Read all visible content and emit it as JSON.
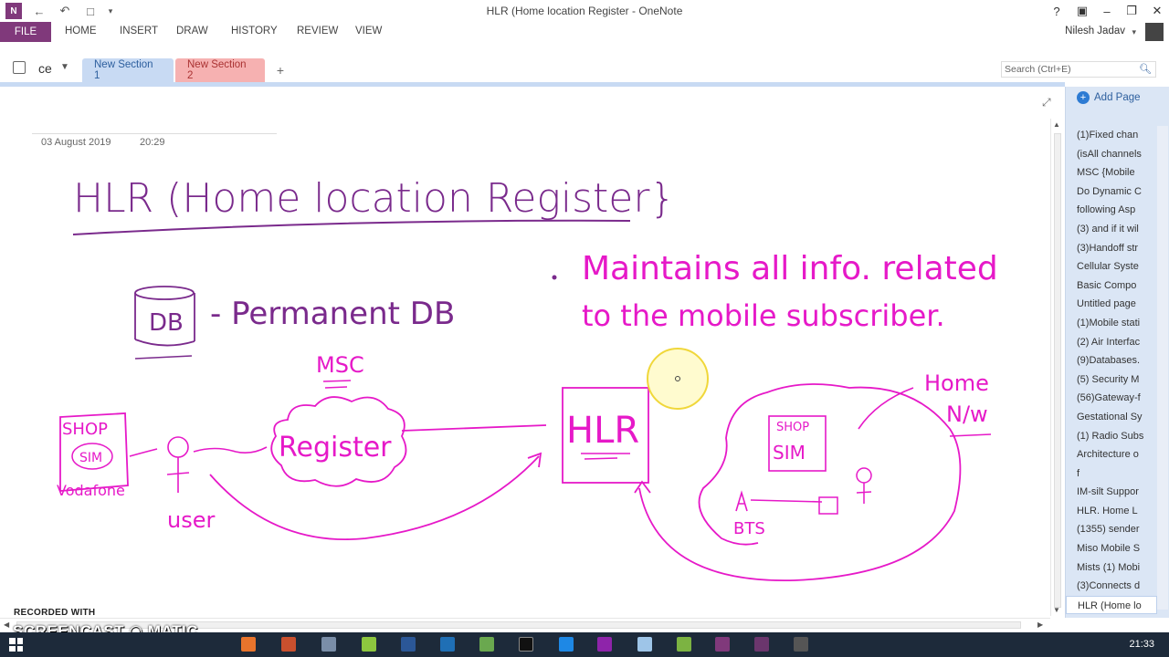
{
  "window": {
    "title": "HLR (Home location Register - OneNote",
    "help": "?"
  },
  "ribbon": {
    "tabs": [
      "FILE",
      "HOME",
      "INSERT",
      "DRAW",
      "HISTORY",
      "REVIEW",
      "VIEW"
    ],
    "user": "Nilesh Jadav"
  },
  "notebook": {
    "name": "ce"
  },
  "sections": [
    "New Section 1",
    "New Section 2",
    "+"
  ],
  "search": {
    "placeholder": "Search (Ctrl+E)"
  },
  "page": {
    "date": "03 August 2019",
    "time": "20:29"
  },
  "ink_text": {
    "title": "HLR (Home location Register}",
    "db": "DB",
    "permanent": "- Permanent DB",
    "bullet_line1": "Maintains all info. related",
    "bullet_line2": "to the mobile subscriber.",
    "msc": "MSC",
    "register": "Register",
    "hlr": "HLR",
    "shop": "SHOP",
    "sim": "SIM",
    "vodafone": "Vodafone",
    "user": "user",
    "home": "Home",
    "nw": "N/w",
    "shop2": "SHOP",
    "sim2": "SIM",
    "bts": "BTS"
  },
  "pages_panel": {
    "add_label": "Add Page",
    "items": [
      "(1)Fixed chan",
      "(isAll channels",
      "MSC {Mobile",
      "Do Dynamic C",
      "following Asp",
      "(3) and if it wil",
      "(3)Handoff str",
      "Cellular Syste",
      "Basic Compo",
      "Untitled page",
      "(1)Mobile stati",
      "(2) Air Interfac",
      "(9)Databases.",
      "(5) Security M",
      "(56)Gateway-f",
      "Gestational Sy",
      "(1) Radio Subs",
      "Architecture o",
      "f",
      "IM-silt Suppor",
      "HLR. Home L",
      "(1355) sender",
      "Miso Mobile S",
      "Mists (1) Mobi",
      "(3)Connects d",
      "HLR (Home lo"
    ],
    "selected_index": 25
  },
  "watermark": {
    "recorded": "RECORDED WITH",
    "brand": "SCREENCAST ◉ MATIC"
  },
  "taskbar": {
    "clock": "21:33"
  },
  "colors": {
    "ink_pink": "#e619c8",
    "ink_purple": "#7a2a8c",
    "file_tab": "#80397b",
    "accent": "#2d5f9e"
  }
}
